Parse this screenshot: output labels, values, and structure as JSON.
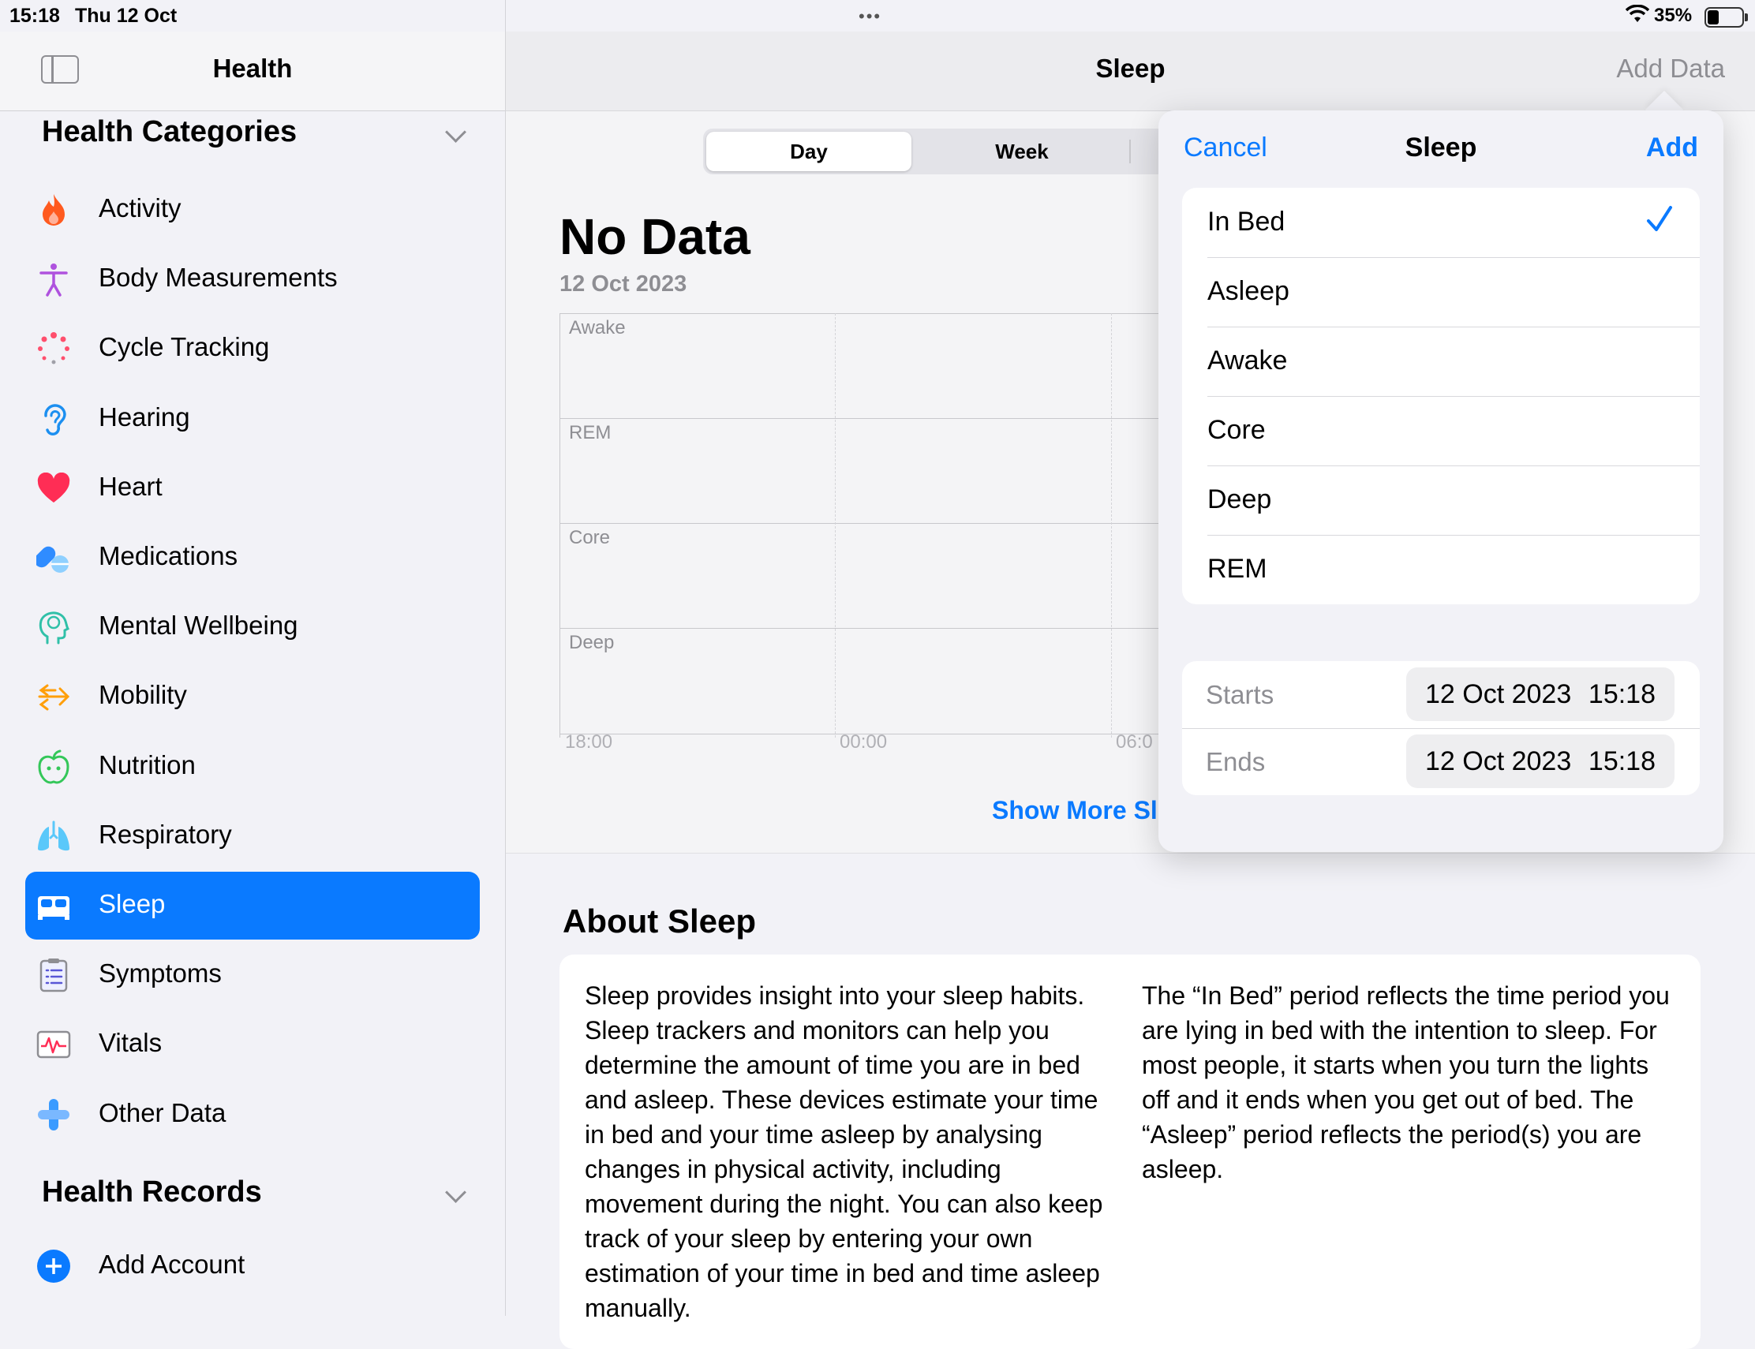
{
  "status_bar": {
    "time": "15:18",
    "date": "Thu 12 Oct",
    "battery": "35%",
    "multitask_dots": "•••"
  },
  "sidebar": {
    "title": "Health",
    "categories_title": "Health Categories",
    "items": [
      {
        "label": "Activity",
        "icon": "flame-icon"
      },
      {
        "label": "Body Measurements",
        "icon": "figure-icon"
      },
      {
        "label": "Cycle Tracking",
        "icon": "cycle-dots-icon"
      },
      {
        "label": "Hearing",
        "icon": "ear-icon"
      },
      {
        "label": "Heart",
        "icon": "heart-icon"
      },
      {
        "label": "Medications",
        "icon": "pills-icon"
      },
      {
        "label": "Mental Wellbeing",
        "icon": "head-icon"
      },
      {
        "label": "Mobility",
        "icon": "arrows-icon"
      },
      {
        "label": "Nutrition",
        "icon": "apple-icon"
      },
      {
        "label": "Respiratory",
        "icon": "lungs-icon"
      },
      {
        "label": "Sleep",
        "icon": "bed-icon",
        "selected": true
      },
      {
        "label": "Symptoms",
        "icon": "clipboard-icon"
      },
      {
        "label": "Vitals",
        "icon": "waveform-icon"
      },
      {
        "label": "Other Data",
        "icon": "plus-cross-icon"
      }
    ],
    "records_title": "Health Records",
    "add_account": "Add Account"
  },
  "main": {
    "title": "Sleep",
    "add_data": "Add Data",
    "segments": [
      "Day",
      "Week"
    ],
    "no_data": "No Data",
    "date": "12 Oct 2023",
    "chart_rows": [
      "Awake",
      "REM",
      "Core",
      "Deep"
    ],
    "time_ticks": [
      "18:00",
      "00:00",
      "06:0"
    ],
    "show_more": "Show More Sl",
    "about_title": "About Sleep",
    "about_left": "Sleep provides insight into your sleep habits. Sleep trackers and monitors can help you determine the amount of time you are in bed and asleep. These devices estimate your time in bed and your time asleep by analysing changes in physical activity, including movement during the night. You can also keep track of your sleep by entering your own estimation of your time in bed and time asleep manually.",
    "about_right": "The “In Bed” period reflects the time period you are lying in bed with the intention to sleep. For most people, it starts when you turn the lights off and it ends when you get out of bed. The “Asleep” period reflects the period(s) you are asleep."
  },
  "popover": {
    "cancel": "Cancel",
    "title": "Sleep",
    "add": "Add",
    "options": [
      "In Bed",
      "Asleep",
      "Awake",
      "Core",
      "Deep",
      "REM"
    ],
    "selected_option": "In Bed",
    "starts_label": "Starts",
    "starts_date": "12 Oct 2023",
    "starts_time": "15:18",
    "ends_label": "Ends",
    "ends_date": "12 Oct 2023",
    "ends_time": "15:18"
  },
  "colors": {
    "accent": "#0a7aff",
    "secondary_text": "#8e8e93"
  }
}
